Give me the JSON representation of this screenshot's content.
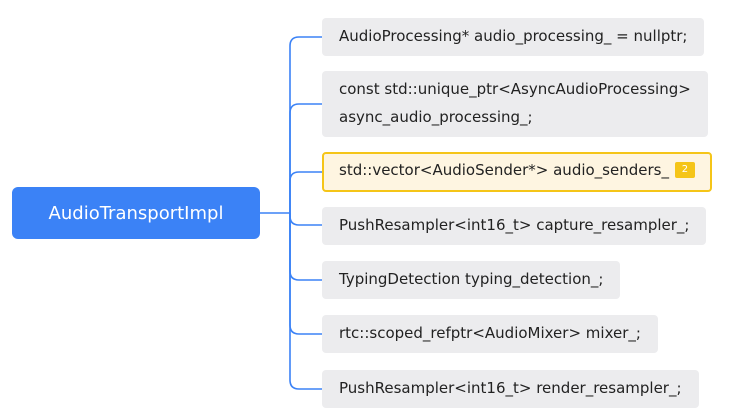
{
  "root": {
    "label": "AudioTransportImpl"
  },
  "children": [
    {
      "label": "AudioProcessing* audio_processing_ = nullptr;"
    },
    {
      "line1": "const std::unique_ptr<AsyncAudioProcessing>",
      "line2": "async_audio_processing_;"
    },
    {
      "label": "std::vector<AudioSender*> audio_senders_",
      "badge": "2"
    },
    {
      "label": "PushResampler<int16_t> capture_resampler_;"
    },
    {
      "label": "TypingDetection typing_detection_;"
    },
    {
      "label": "rtc::scoped_refptr<AudioMixer> mixer_;"
    },
    {
      "label": "PushResampler<int16_t> render_resampler_;"
    }
  ],
  "colors": {
    "root": "#3b82f6",
    "connector": "#3b82f6",
    "node": "#ececee",
    "highlight": "#f5c518"
  }
}
